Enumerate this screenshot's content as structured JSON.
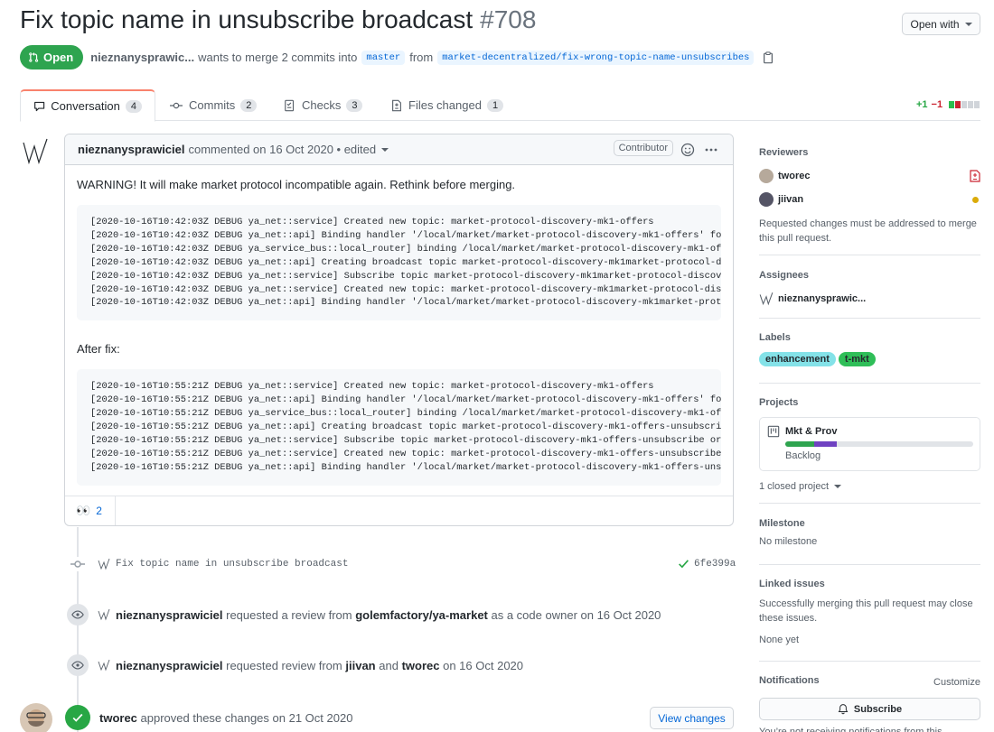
{
  "pr": {
    "title": "Fix topic name in unsubscribe broadcast",
    "number": "#708",
    "state": "Open",
    "author": "nieznanysprawic...",
    "wants_text": "wants to merge 2 commits into",
    "base_branch": "master",
    "from_text": "from",
    "head_branch": "market-decentralized/fix-wrong-topic-name-unsubscribes"
  },
  "open_with": "Open with",
  "tabs": [
    {
      "label": "Conversation",
      "count": "4"
    },
    {
      "label": "Commits",
      "count": "2"
    },
    {
      "label": "Checks",
      "count": "3"
    },
    {
      "label": "Files changed",
      "count": "1"
    }
  ],
  "diffstat": {
    "added": "+1",
    "removed": "−1"
  },
  "comment": {
    "author": "nieznanysprawiciel",
    "meta": "commented on 16 Oct 2020 • edited",
    "badge": "Contributor",
    "warning": "WARNING! It will make market protocol incompatible again. Rethink before merging.",
    "before_lines": [
      "[2020-10-16T10:42:03Z DEBUG ya_net::service] Created new topic: market-protocol-discovery-mk1-offers",
      "[2020-10-16T10:42:03Z DEBUG ya_net::api] Binding handler '/local/market/market-protocol-discovery-mk1-offers' fo",
      "[2020-10-16T10:42:03Z DEBUG ya_service_bus::local_router] binding /local/market/market-protocol-discovery-mk1-of",
      "[2020-10-16T10:42:03Z DEBUG ya_net::api] Creating broadcast topic market-protocol-discovery-mk1market-protocol-d",
      "[2020-10-16T10:42:03Z DEBUG ya_net::service] Subscribe topic market-protocol-discovery-mk1market-protocol-discov",
      "[2020-10-16T10:42:03Z DEBUG ya_net::service] Created new topic: market-protocol-discovery-mk1market-protocol-dis",
      "[2020-10-16T10:42:03Z DEBUG ya_net::api] Binding handler '/local/market/market-protocol-discovery-mk1market-prot"
    ],
    "after_label": "After fix:",
    "after_lines": [
      "[2020-10-16T10:55:21Z DEBUG ya_net::service] Created new topic: market-protocol-discovery-mk1-offers",
      "[2020-10-16T10:55:21Z DEBUG ya_net::api] Binding handler '/local/market/market-protocol-discovery-mk1-offers' fo",
      "[2020-10-16T10:55:21Z DEBUG ya_service_bus::local_router] binding /local/market/market-protocol-discovery-mk1-of",
      "[2020-10-16T10:55:21Z DEBUG ya_net::api] Creating broadcast topic market-protocol-discovery-mk1-offers-unsubscri",
      "[2020-10-16T10:55:21Z DEBUG ya_net::service] Subscribe topic market-protocol-discovery-mk1-offers-unsubscribe or",
      "[2020-10-16T10:55:21Z DEBUG ya_net::service] Created new topic: market-protocol-discovery-mk1-offers-unsubscribe",
      "[2020-10-16T10:55:21Z DEBUG ya_net::api] Binding handler '/local/market/market-protocol-discovery-mk1-offers-uns"
    ],
    "reaction_emoji": "👀",
    "reaction_count": "2"
  },
  "timeline": {
    "commit_message": "Fix topic name in unsubscribe broadcast",
    "commit_sha": "6fe399a",
    "event1": {
      "actor": "nieznanysprawiciel",
      "text1": "requested a review from",
      "target": "golemfactory/ya-market",
      "text2": "as a code owner on 16 Oct 2020"
    },
    "event2": {
      "actor": "nieznanysprawiciel",
      "text1": "requested review from",
      "target1": "jiivan",
      "and": "and",
      "target2": "tworec",
      "text2": "on 16 Oct 2020"
    },
    "event3": {
      "actor": "tworec",
      "text": "approved these changes on 21 Oct 2020",
      "button": "View changes"
    }
  },
  "sidebar": {
    "reviewers_title": "Reviewers",
    "reviewers": [
      {
        "name": "tworec"
      },
      {
        "name": "jiivan"
      }
    ],
    "reviewers_note": "Requested changes must be addressed to merge this pull request.",
    "assignees_title": "Assignees",
    "assignee": "nieznanysprawic...",
    "labels_title": "Labels",
    "labels": [
      {
        "name": "enhancement",
        "color": "#84e2e8"
      },
      {
        "name": "t-mkt",
        "color": "#2fbe58"
      }
    ],
    "projects_title": "Projects",
    "project_name": "Mkt & Prov",
    "project_column": "Backlog",
    "closed_projects": "1 closed project",
    "milestone_title": "Milestone",
    "milestone_value": "No milestone",
    "linked_title": "Linked issues",
    "linked_note": "Successfully merging this pull request may close these issues.",
    "linked_value": "None yet",
    "notifications_title": "Notifications",
    "customize": "Customize",
    "subscribe": "Subscribe",
    "not_receiving": "You’re not receiving notifications from this"
  }
}
